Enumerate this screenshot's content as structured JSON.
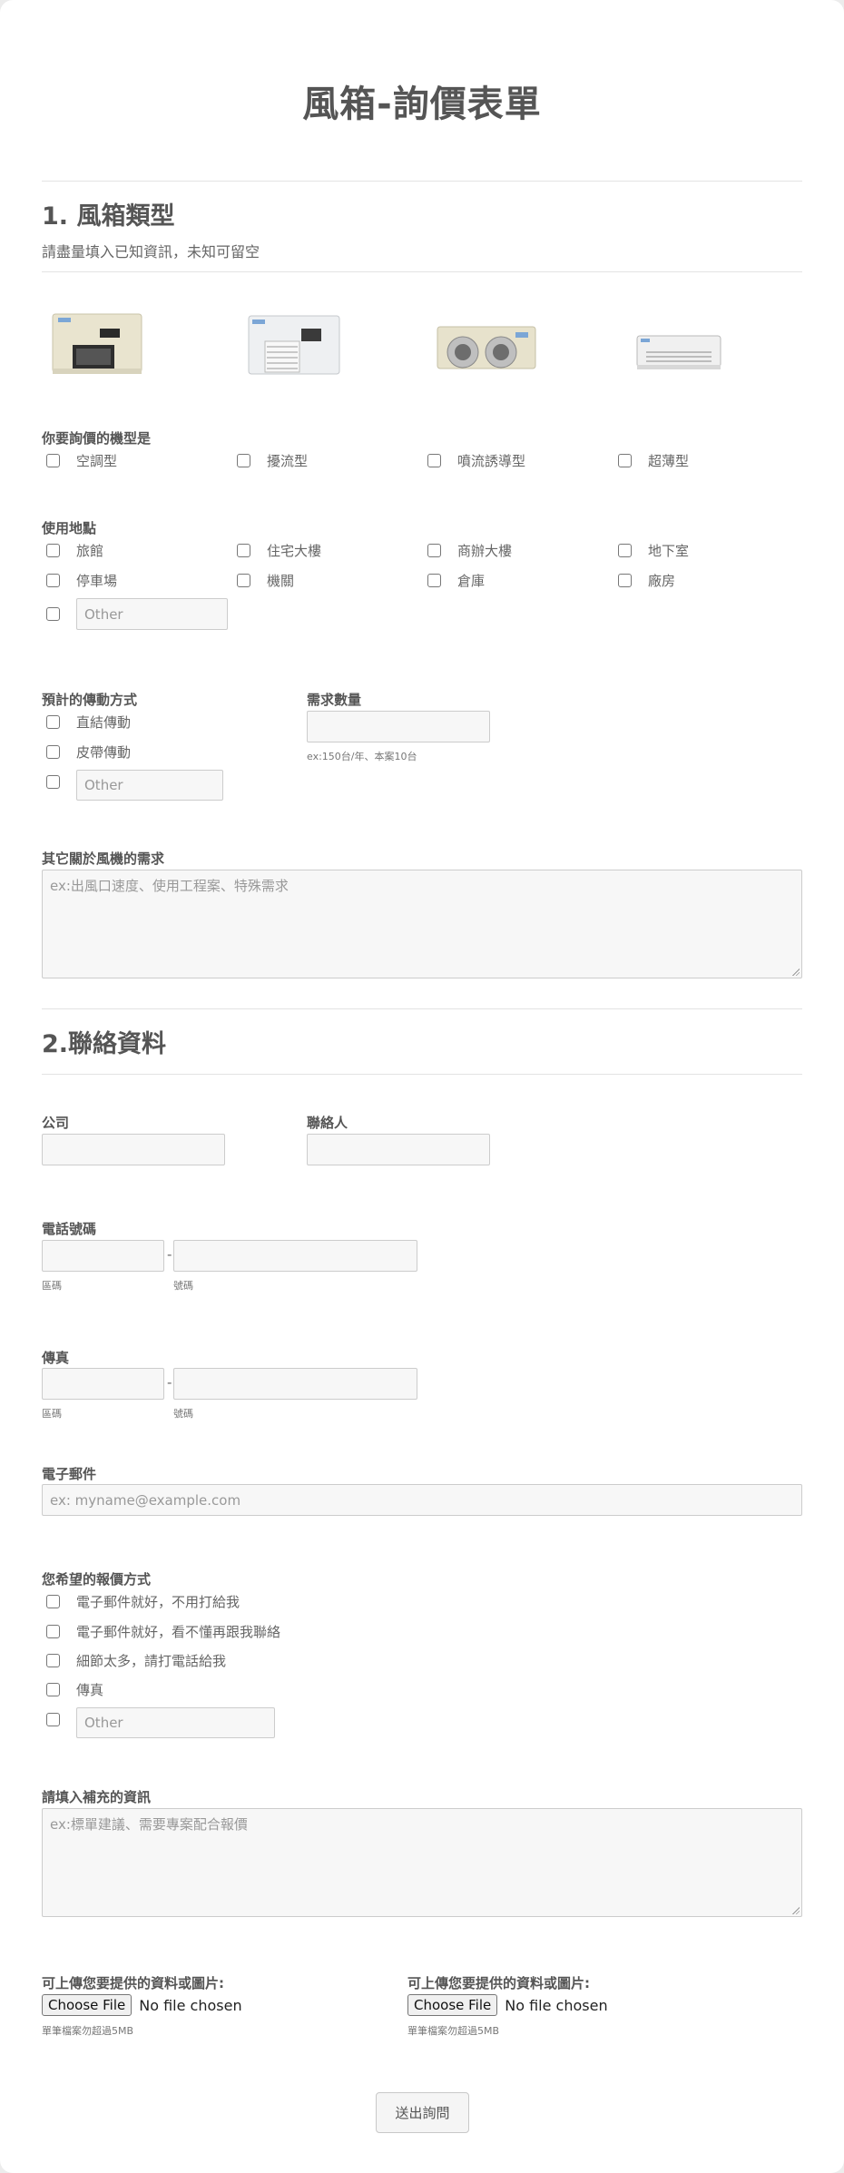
{
  "form_title": "風箱-詢價表單",
  "section1": {
    "title": "1. 風箱類型",
    "subtitle": "請盡量填入已知資訊，未知可留空"
  },
  "machine_type": {
    "label": "你要詢價的機型是",
    "options": [
      "空調型",
      "擾流型",
      "噴流誘導型",
      "超薄型"
    ]
  },
  "location": {
    "label": "使用地點",
    "options": [
      "旅館",
      "住宅大樓",
      "商辦大樓",
      "地下室",
      "停車場",
      "機關",
      "倉庫",
      "廠房"
    ],
    "other_placeholder": "Other"
  },
  "drive": {
    "label": "預計的傳動方式",
    "options": [
      "直結傳動",
      "皮帶傳動"
    ],
    "other_placeholder": "Other"
  },
  "quantity": {
    "label": "需求數量",
    "hint": "ex:150台/年、本案10台"
  },
  "other_needs": {
    "label": "其它關於風機的需求",
    "placeholder": "ex:出風口速度、使用工程案、特殊需求"
  },
  "section2": {
    "title": "2.聯絡資料"
  },
  "company": {
    "label": "公司"
  },
  "contact": {
    "label": "聯絡人"
  },
  "phone": {
    "label": "電話號碼",
    "dash": "-",
    "area_hint": "區碼",
    "number_hint": "號碼"
  },
  "fax": {
    "label": "傳真",
    "dash": "-",
    "area_hint": "區碼",
    "number_hint": "號碼"
  },
  "email": {
    "label": "電子郵件",
    "placeholder": "ex: myname@example.com"
  },
  "quote_method": {
    "label": "您希望的報價方式",
    "options": [
      "電子郵件就好，不用打給我",
      "電子郵件就好，看不懂再跟我聯絡",
      "細節太多，請打電話給我",
      "傳真"
    ],
    "other_placeholder": "Other"
  },
  "extra_info": {
    "label": "請填入補充的資訊",
    "placeholder": "ex:標單建議、需要專案配合報價"
  },
  "uploads": [
    {
      "label": "可上傳您要提供的資料或圖片:",
      "button": "Choose File",
      "status": "No file chosen",
      "hint": "單筆檔案勿超過5MB"
    },
    {
      "label": "可上傳您要提供的資料或圖片:",
      "button": "Choose File",
      "status": "No file chosen",
      "hint": "單筆檔案勿超過5MB"
    }
  ],
  "submit_label": "送出詢問",
  "product_images": [
    "air-conditioning-fan-box-image",
    "turbulence-fan-box-image",
    "jet-induction-fan-box-image",
    "ultra-thin-fan-box-image"
  ]
}
